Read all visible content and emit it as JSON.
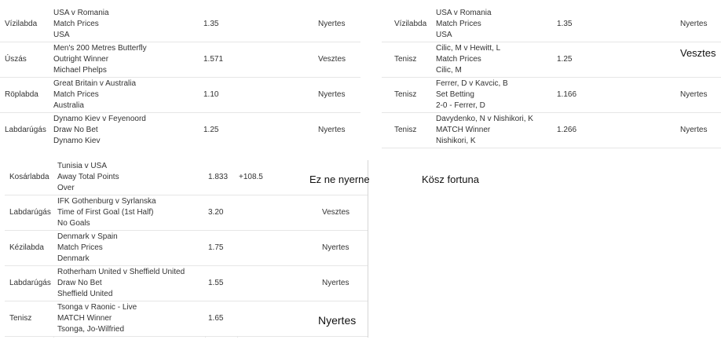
{
  "panel_a": {
    "rows": [
      {
        "sport": "Vízilabda",
        "match": "USA v Romania",
        "market": "Match Prices",
        "selection": "USA",
        "odds": "1.35",
        "result": "Nyertes"
      },
      {
        "sport": "Úszás",
        "match": "Men's 200 Metres Butterfly",
        "market": "Outright Winner",
        "selection": "Michael Phelps",
        "odds": "1.571",
        "result": "Vesztes"
      },
      {
        "sport": "Röplabda",
        "match": "Great Britain v Australia",
        "market": "Match Prices",
        "selection": "Australia",
        "odds": "1.10",
        "result": "Nyertes"
      },
      {
        "sport": "Labdarúgás",
        "match": "Dynamo Kiev v Feyenoord",
        "market": "Draw No Bet",
        "selection": "Dynamo Kiev",
        "odds": "1.25",
        "result": "Nyertes"
      }
    ]
  },
  "panel_b": {
    "rows": [
      {
        "sport": "Vízilabda",
        "match": "USA v Romania",
        "market": "Match Prices",
        "selection": "USA",
        "odds": "1.35",
        "result": "Nyertes"
      },
      {
        "sport": "Tenisz",
        "match": "Cilic, M v Hewitt, L",
        "market": "Match Prices",
        "selection": "Cilic, M",
        "odds": "1.25",
        "result": ""
      },
      {
        "sport": "Tenisz",
        "match": "Ferrer, D v Kavcic, B",
        "market": "Set Betting",
        "selection": "2-0 - Ferrer, D",
        "odds": "1.166",
        "result": "Nyertes"
      },
      {
        "sport": "Tenisz",
        "match": "Davydenko, N v Nishikori, K",
        "market": "MATCH Winner",
        "selection": "Nishikori, K",
        "odds": "1.266",
        "result": "Nyertes"
      }
    ],
    "overlay_result": "Vesztes"
  },
  "panel_c": {
    "rows": [
      {
        "sport": "Kosárlabda",
        "match": "Tunisia v USA",
        "market": "Away Total Points",
        "selection": "Over",
        "odds": "1.833",
        "line": "+108.5",
        "result": ""
      },
      {
        "sport": "Labdarúgás",
        "match": "IFK Gothenburg v Syrlanska",
        "market": "Time of First Goal (1st Half)",
        "selection": "No Goals",
        "odds": "3.20",
        "line": "",
        "result": "Vesztes"
      },
      {
        "sport": "Kézilabda",
        "match": "Denmark v Spain",
        "market": "Match Prices",
        "selection": "Denmark",
        "odds": "1.75",
        "line": "",
        "result": "Nyertes"
      },
      {
        "sport": "Labdarúgás",
        "match": "Rotherham United v Sheffield United",
        "market": "Draw No Bet",
        "selection": "Sheffield United",
        "odds": "1.55",
        "line": "",
        "result": "Nyertes"
      },
      {
        "sport": "Tenisz",
        "match": "Tsonga v Raonic - Live",
        "market": "MATCH Winner",
        "selection": "Tsonga, Jo-Wilfried",
        "odds": "1.65",
        "line": "",
        "result": ""
      }
    ],
    "overlay_top": "Ez ne nyerne",
    "overlay_bottom": "Nyertes"
  },
  "note": "Kösz fortuna"
}
